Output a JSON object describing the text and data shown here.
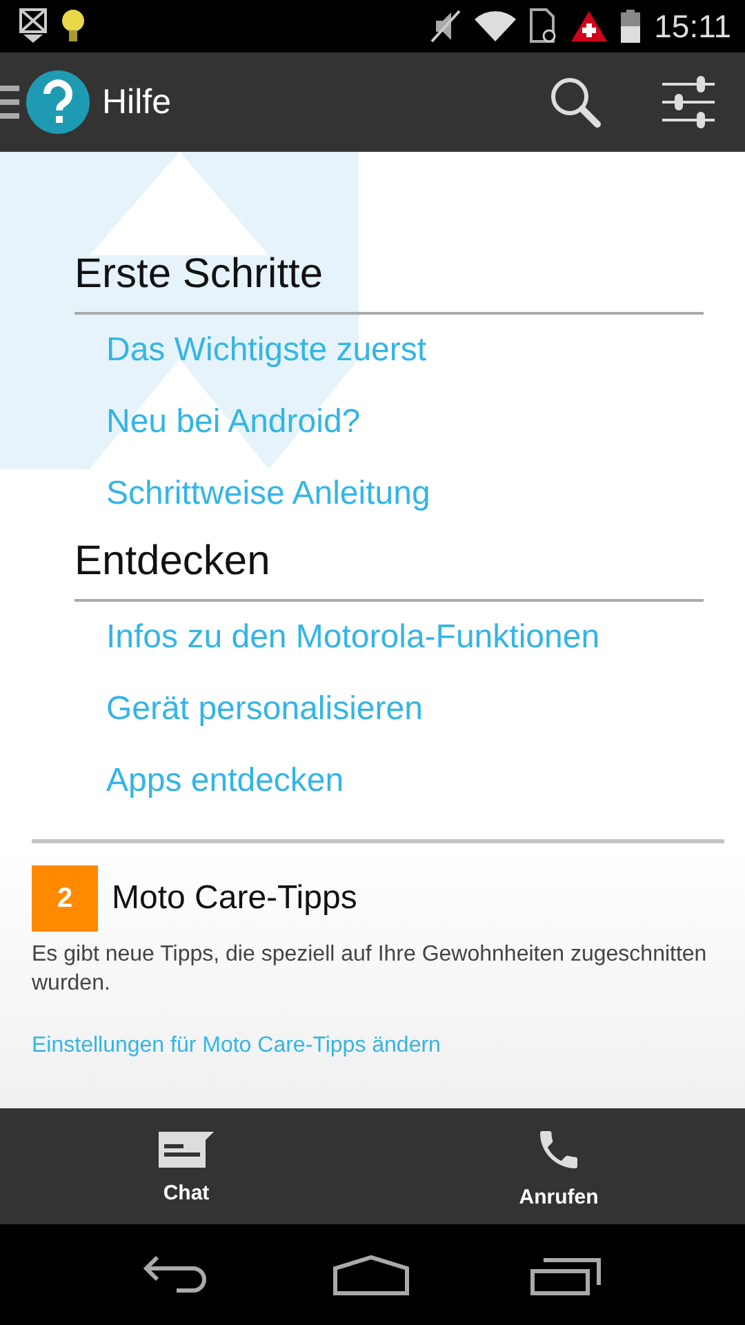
{
  "status_bar": {
    "time": "15:11"
  },
  "toolbar": {
    "title": "Hilfe"
  },
  "sections": [
    {
      "heading": "Erste Schritte",
      "links": [
        "Das Wichtigste zuerst",
        "Neu bei Android?",
        "Schrittweise Anleitung"
      ]
    },
    {
      "heading": "Entdecken",
      "links": [
        "Infos zu den Motorola-Funktionen",
        "Gerät personalisieren",
        "Apps entdecken"
      ]
    }
  ],
  "tips_card": {
    "badge": "2",
    "title": "Moto Care-Tipps",
    "description": "Es gibt neue Tipps, die speziell auf Ihre Gewohnheiten zugeschnitten wurden.",
    "link": "Einstellungen für Moto Care-Tipps ändern"
  },
  "bottom_actions": [
    {
      "kind": "chat",
      "label": "Chat"
    },
    {
      "kind": "call",
      "label": "Anrufen"
    }
  ]
}
